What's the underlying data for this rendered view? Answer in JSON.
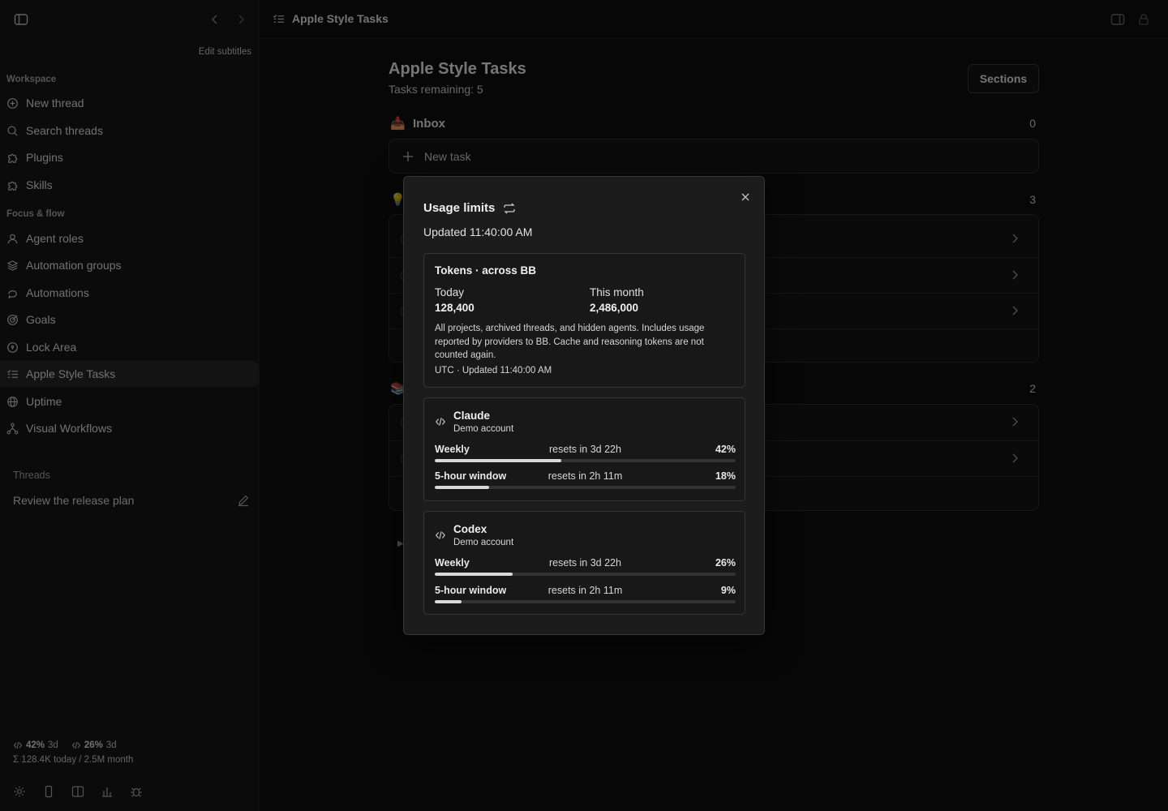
{
  "sidebar": {
    "edit_subtitles": "Edit subtitles",
    "workspace_label": "Workspace",
    "workspace_items": [
      {
        "label": "New thread",
        "icon": "plus-circle-icon"
      },
      {
        "label": "Search threads",
        "icon": "search-icon"
      },
      {
        "label": "Plugins",
        "icon": "puzzle-icon"
      },
      {
        "label": "Skills",
        "icon": "puzzle-icon"
      }
    ],
    "focus_label": "Focus & flow",
    "focus_items": [
      {
        "label": "Agent roles",
        "icon": "user-icon"
      },
      {
        "label": "Automation groups",
        "icon": "layers-icon"
      },
      {
        "label": "Automations",
        "icon": "loop-icon"
      },
      {
        "label": "Goals",
        "icon": "target-icon"
      },
      {
        "label": "Lock Area",
        "icon": "lock-circle-icon"
      },
      {
        "label": "Apple Style Tasks",
        "icon": "checklist-icon",
        "active": true
      },
      {
        "label": "Uptime",
        "icon": "globe-icon"
      },
      {
        "label": "Visual Workflows",
        "icon": "workflow-icon"
      }
    ],
    "threads_label": "Threads",
    "thread": "Review the release plan",
    "stats": {
      "claude_pct": "42%",
      "claude_reset": "3d",
      "codex_pct": "26%",
      "codex_reset": "3d",
      "tokens_line": "Σ 128.4K today / 2.5M month"
    }
  },
  "topbar": {
    "title": "Apple Style Tasks"
  },
  "main": {
    "title": "Apple Style Tasks",
    "subtitle": "Tasks remaining: 5",
    "sections_button": "Sections",
    "inbox": {
      "emoji": "📥",
      "name": "Inbox",
      "count": "0",
      "new_task": "New task"
    },
    "group2": {
      "emoji": "💡",
      "count": "3"
    },
    "group3": {
      "emoji": "📚",
      "count": "2"
    }
  },
  "modal": {
    "title": "Usage limits",
    "updated": "Updated 11:40:00 AM",
    "tokens": {
      "title": "Tokens · across BB",
      "today_label": "Today",
      "today_value": "128,400",
      "month_label": "This month",
      "month_value": "2,486,000",
      "description": "All projects, archived threads, and hidden agents. Includes usage reported by providers to BB. Cache and reasoning tokens are not counted again.",
      "footer": "UTC · Updated 11:40:00 AM"
    },
    "providers": [
      {
        "name": "Claude",
        "account": "Demo account",
        "meters": [
          {
            "label": "Weekly",
            "reset": "resets in 3d 22h",
            "percent": "42%",
            "value": 0.42
          },
          {
            "label": "5-hour window",
            "reset": "resets in 2h 11m",
            "percent": "18%",
            "value": 0.18
          }
        ]
      },
      {
        "name": "Codex",
        "account": "Demo account",
        "meters": [
          {
            "label": "Weekly",
            "reset": "resets in 3d 22h",
            "percent": "26%",
            "value": 0.26
          },
          {
            "label": "5-hour window",
            "reset": "resets in 2h 11m",
            "percent": "9%",
            "value": 0.09
          }
        ]
      }
    ]
  }
}
